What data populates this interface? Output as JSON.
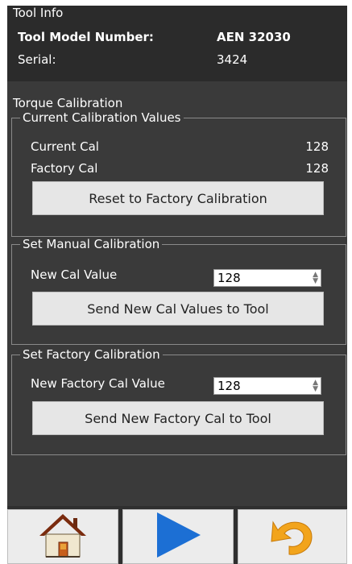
{
  "tool_info": {
    "title": "Tool Info",
    "model_label": "Tool Model Number:",
    "model_value": "AEN 32030",
    "serial_label": "Serial:",
    "serial_value": "3424"
  },
  "torque": {
    "title": "Torque Calibration",
    "current": {
      "legend": "Current Calibration Values",
      "current_cal_label": "Current Cal",
      "current_cal_value": "128",
      "factory_cal_label": "Factory Cal",
      "factory_cal_value": "128",
      "reset_button": "Reset to Factory Calibration"
    },
    "manual": {
      "legend": "Set Manual Calibration",
      "new_cal_label": "New Cal Value",
      "new_cal_value": "128",
      "send_button": "Send New Cal Values to Tool"
    },
    "factory": {
      "legend": "Set Factory Calibration",
      "new_factory_label": "New Factory Cal Value",
      "new_factory_value": "128",
      "send_button": "Send New Factory Cal to Tool"
    }
  },
  "nav": {
    "home_icon": "home-icon",
    "play_icon": "play-icon",
    "undo_icon": "undo-icon"
  },
  "colors": {
    "background": "#3a3a3a",
    "play_blue": "#1c6fd4",
    "undo_orange": "#f2a41c"
  }
}
